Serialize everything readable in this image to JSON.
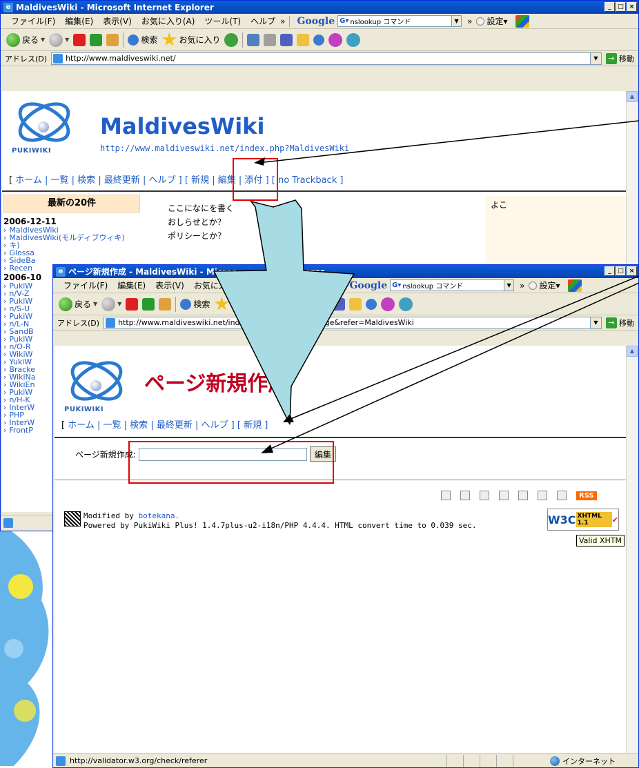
{
  "browser": {
    "menu": [
      "ファイル(F)",
      "編集(E)",
      "表示(V)",
      "お気に入り(A)",
      "ツール(T)",
      "ヘルプ"
    ],
    "menu_more": "»",
    "google_label": "Google",
    "google_search_value": "nslookup コマンド",
    "settings_label": "設定▾",
    "back_label": "戻る",
    "search_label": "検索",
    "favorites_label": "お気に入り",
    "address_label": "アドレス(D)",
    "go_label": "移動"
  },
  "back_window": {
    "title": "MaldivesWiki - Microsoft Internet Explorer",
    "url": "http://www.maldiveswiki.net/",
    "site_title": "MaldivesWiki",
    "site_url": "http://www.maldiveswiki.net/index.php?MaldivesWiki",
    "nav_prefix": "[",
    "nav_items": [
      "ホーム",
      "一覧",
      "検索",
      "最終更新",
      "ヘルプ"
    ],
    "nav_new": "新規",
    "nav_edit": "編集",
    "nav_attach": "添付",
    "nav_trackback": "no Trackback",
    "menu_title": "最新の20件",
    "date1": "2006-12-11",
    "date1_items": [
      "MaldivesWiki",
      "MaldivesWiki(モルディブウィキ)"
    ],
    "date1_more": [
      "Glossa",
      "SideBa",
      "Recen"
    ],
    "date2": "2006-10",
    "date2_items": [
      "PukiW",
      "n/V-Z",
      "PukiW",
      "n/S-U",
      "PukiW",
      "n/L-N",
      "SandB",
      "PukiW",
      "n/O-R",
      "WikiW",
      "YukiW",
      "Bracke",
      "WikiNa",
      "WikiEn",
      "PukiW",
      "n/H-K",
      "InterW",
      "PHP",
      "InterW",
      "FrontP"
    ],
    "body_lines": [
      "ここになにを書く",
      "おしらせとか？",
      "ポリシーとか？"
    ],
    "right_text": "よこ"
  },
  "front_window": {
    "title": "ページ新規作成 - MaldivesWiki - Micros",
    "title_tail": "t Explorer",
    "url": "http://www.maldiveswiki.net/index.php?plugin=newpage&refer=MaldivesWiki",
    "page_title": "ページ新規作成",
    "nav_items": [
      "ホーム",
      "一覧",
      "検索",
      "最終更新",
      "ヘルプ"
    ],
    "nav_new": "新規",
    "form_label": "ページ新規作成:",
    "form_value": "",
    "form_button": "編集",
    "rss_label": "RSS",
    "modified_prefix": "Modified by ",
    "modified_user": "botekana.",
    "powered_by": "Powered by PukiWiki Plus! 1.4.7plus-u2-i18n/PHP 4.4.4. HTML convert time to 0.039 sec.",
    "w3c_label": "W3C",
    "xhtml_label": "XHTML 1.1",
    "tooltip": "Valid XHTM",
    "status_text": "http://validator.w3.org/check/referer",
    "zone_text": "インターネット"
  },
  "logo_text": "PUKIWIKI",
  "colors": {
    "annotation": "#e00000",
    "arrow_fill": "#a8dce4",
    "link": "#215dc6",
    "page_title": "#c00020"
  }
}
